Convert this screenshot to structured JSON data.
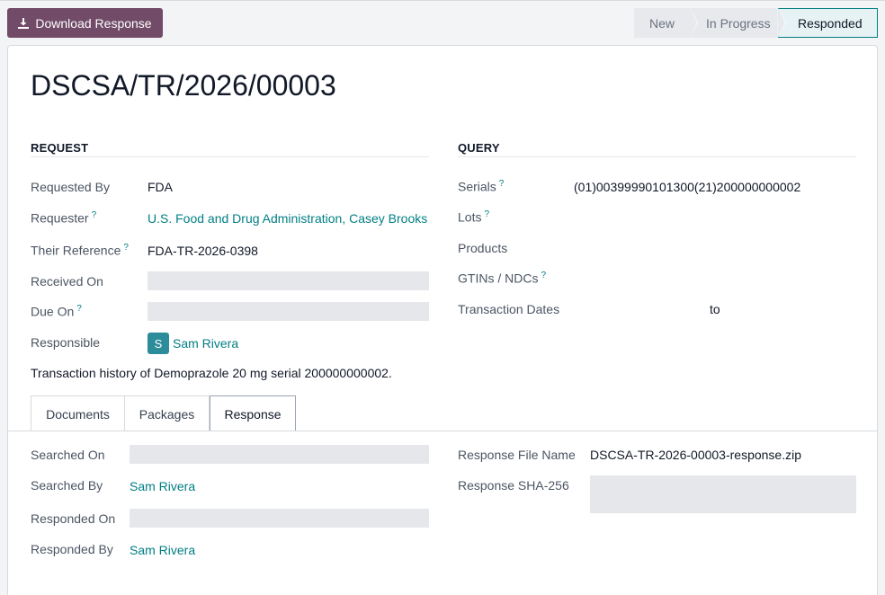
{
  "toolbar": {
    "download_label": "Download Response"
  },
  "status": {
    "stages": [
      "New",
      "In Progress",
      "Responded"
    ],
    "active": "Responded"
  },
  "record": {
    "title": "DSCSA/TR/2026/00003"
  },
  "request": {
    "heading": "REQUEST",
    "requested_by_label": "Requested By",
    "requested_by": "FDA",
    "requester_label": "Requester",
    "requester": "U.S. Food and Drug Administration, Casey Brooks",
    "their_reference_label": "Their Reference",
    "their_reference": "FDA-TR-2026-0398",
    "received_on_label": "Received On",
    "due_on_label": "Due On",
    "responsible_label": "Responsible",
    "responsible_initial": "S",
    "responsible": "Sam Rivera",
    "note": "Transaction history of Demoprazole 20 mg serial 200000000002."
  },
  "query": {
    "heading": "QUERY",
    "serials_label": "Serials",
    "serials": "(01)00399990101300(21)200000000002",
    "lots_label": "Lots",
    "products_label": "Products",
    "gtins_label": "GTINs / NDCs",
    "transaction_dates_label": "Transaction Dates",
    "transaction_dates_to": "to"
  },
  "tabs": [
    "Documents",
    "Packages",
    "Response"
  ],
  "response": {
    "searched_on_label": "Searched On",
    "searched_by_label": "Searched By",
    "searched_by": "Sam Rivera",
    "responded_on_label": "Responded On",
    "responded_by_label": "Responded By",
    "responded_by": "Sam Rivera",
    "file_name_label": "Response File Name",
    "file_name": "DSCSA-TR-2026-00003-response.zip",
    "sha_label": "Response SHA-256"
  },
  "help_mark": "?",
  "colors": {
    "primary": "#714b67",
    "accent": "#017e84"
  }
}
